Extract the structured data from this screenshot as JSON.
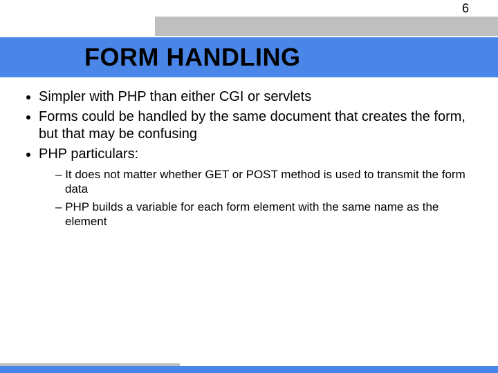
{
  "page_number": "6",
  "title": "FORM HANDLING",
  "bullets": [
    "Simpler with PHP than either CGI or servlets",
    "Forms could be handled by the same document that creates the form, but that may be confusing",
    "PHP particulars:"
  ],
  "sub_bullets": [
    "It does not matter whether GET or POST method is used to transmit the form data",
    "PHP builds a variable for each form element with the same name as the element"
  ],
  "colors": {
    "band_blue": "#4a86e8",
    "header_grey": "#bfbfbf"
  }
}
